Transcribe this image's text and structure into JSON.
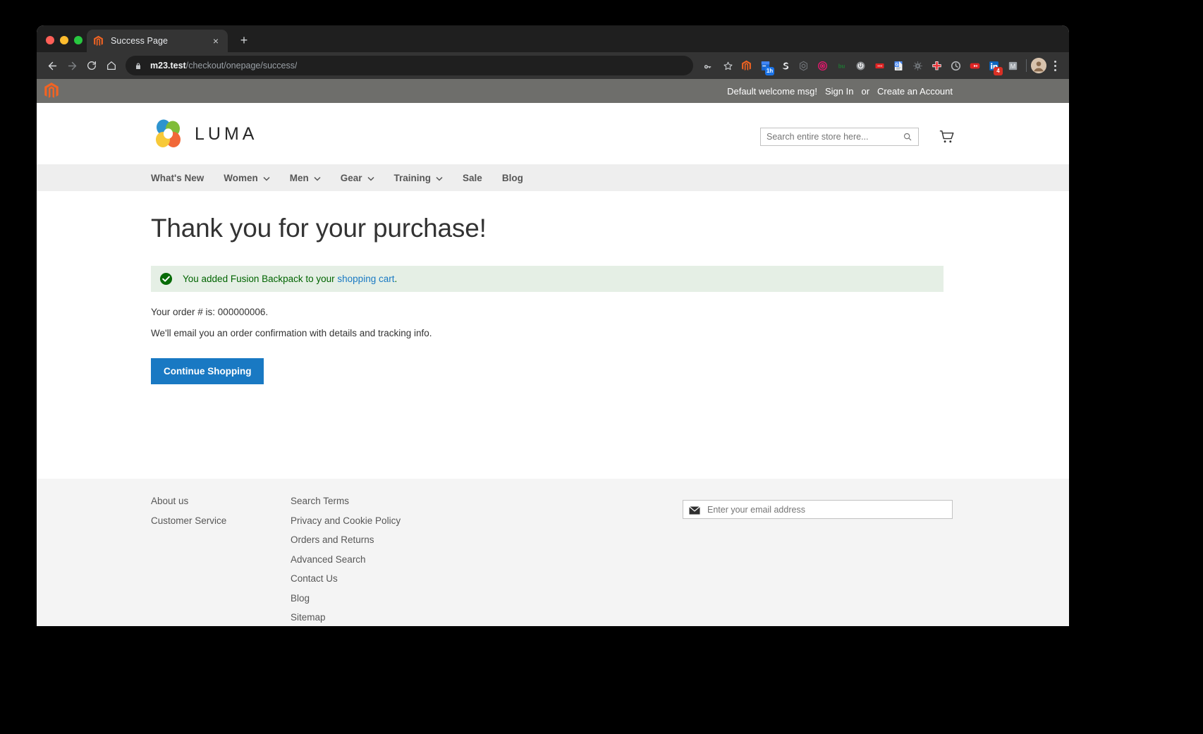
{
  "browser": {
    "tab": {
      "title": "Success Page",
      "favicon": "magento-icon",
      "close": "×"
    },
    "new_tab": "+",
    "url_host": "m23.test",
    "url_path": "/checkout/onepage/success/",
    "nav_back": "back-icon",
    "nav_forward": "forward-icon",
    "nav_reload": "reload-icon",
    "nav_home": "home-icon",
    "omni_key": "password-key-icon",
    "omni_star": "bookmark-star-icon",
    "extensions": [
      {
        "name": "magento-extension-icon",
        "kind": "magento",
        "badge": ""
      },
      {
        "name": "bookmark-manager-extension-icon",
        "kind": "blue-doc",
        "badge": "1h",
        "badge_color": "#1a73e8"
      },
      {
        "name": "simplenote-extension-icon",
        "kind": "s-swirl",
        "badge": ""
      },
      {
        "name": "hexagon-extension-icon",
        "kind": "hexagon",
        "badge": ""
      },
      {
        "name": "target-extension-icon",
        "kind": "target",
        "badge": ""
      },
      {
        "name": "bu-extension-icon",
        "kind": "bu",
        "badge": ""
      },
      {
        "name": "power-extension-icon",
        "kind": "power",
        "badge": ""
      },
      {
        "name": "ellipsis-extension-icon",
        "kind": "reddots",
        "badge": ""
      },
      {
        "name": "google-docs-extension-icon",
        "kind": "gdocs",
        "badge": ""
      },
      {
        "name": "bug-extension-icon",
        "kind": "bug",
        "badge": ""
      },
      {
        "name": "medical-cross-extension-icon",
        "kind": "cross",
        "badge": ""
      },
      {
        "name": "clock-extension-icon",
        "kind": "clock",
        "badge": ""
      },
      {
        "name": "youtube-extension-icon",
        "kind": "youtube",
        "badge": ""
      },
      {
        "name": "linkedin-extension-icon",
        "kind": "linkedin",
        "badge": "4",
        "badge_color": "#d93025"
      },
      {
        "name": "m-extension-icon",
        "kind": "mletter",
        "badge": ""
      }
    ],
    "profile": "profile-avatar",
    "menu": "chrome-menu-icon"
  },
  "panel": {
    "welcome": "Default welcome msg!",
    "sign_in": "Sign In",
    "or": "or",
    "create_account": "Create an Account"
  },
  "header": {
    "logo_text": "LUMA",
    "search_placeholder": "Search entire store here...",
    "search_value": "",
    "cart": "shopping-cart-icon"
  },
  "nav": [
    {
      "label": "What's New",
      "caret": false
    },
    {
      "label": "Women",
      "caret": true
    },
    {
      "label": "Men",
      "caret": true
    },
    {
      "label": "Gear",
      "caret": true
    },
    {
      "label": "Training",
      "caret": true
    },
    {
      "label": "Sale",
      "caret": false
    },
    {
      "label": "Blog",
      "caret": false
    }
  ],
  "main": {
    "title": "Thank you for your purchase!",
    "success_prefix": "You added Fusion Backpack to your ",
    "success_link": "shopping cart",
    "success_suffix": ".",
    "order_line": "Your order # is: 000000006.",
    "email_line": "We'll email you an order confirmation with details and tracking info.",
    "continue_button": "Continue Shopping"
  },
  "footer": {
    "col1": [
      "About us",
      "Customer Service"
    ],
    "col2": [
      "Search Terms",
      "Privacy and Cookie Policy",
      "Orders and Returns",
      "Advanced Search",
      "Contact Us",
      "Blog",
      "Sitemap"
    ],
    "newsletter_placeholder": "Enter your email address",
    "newsletter_value": ""
  },
  "colors": {
    "accent_blue": "#1979c3",
    "success_bg": "#e5efe5",
    "success_text": "#006400",
    "panel_gray": "#6e6e6b",
    "nav_gray": "#eeeeee",
    "footer_gray": "#f4f4f4"
  }
}
